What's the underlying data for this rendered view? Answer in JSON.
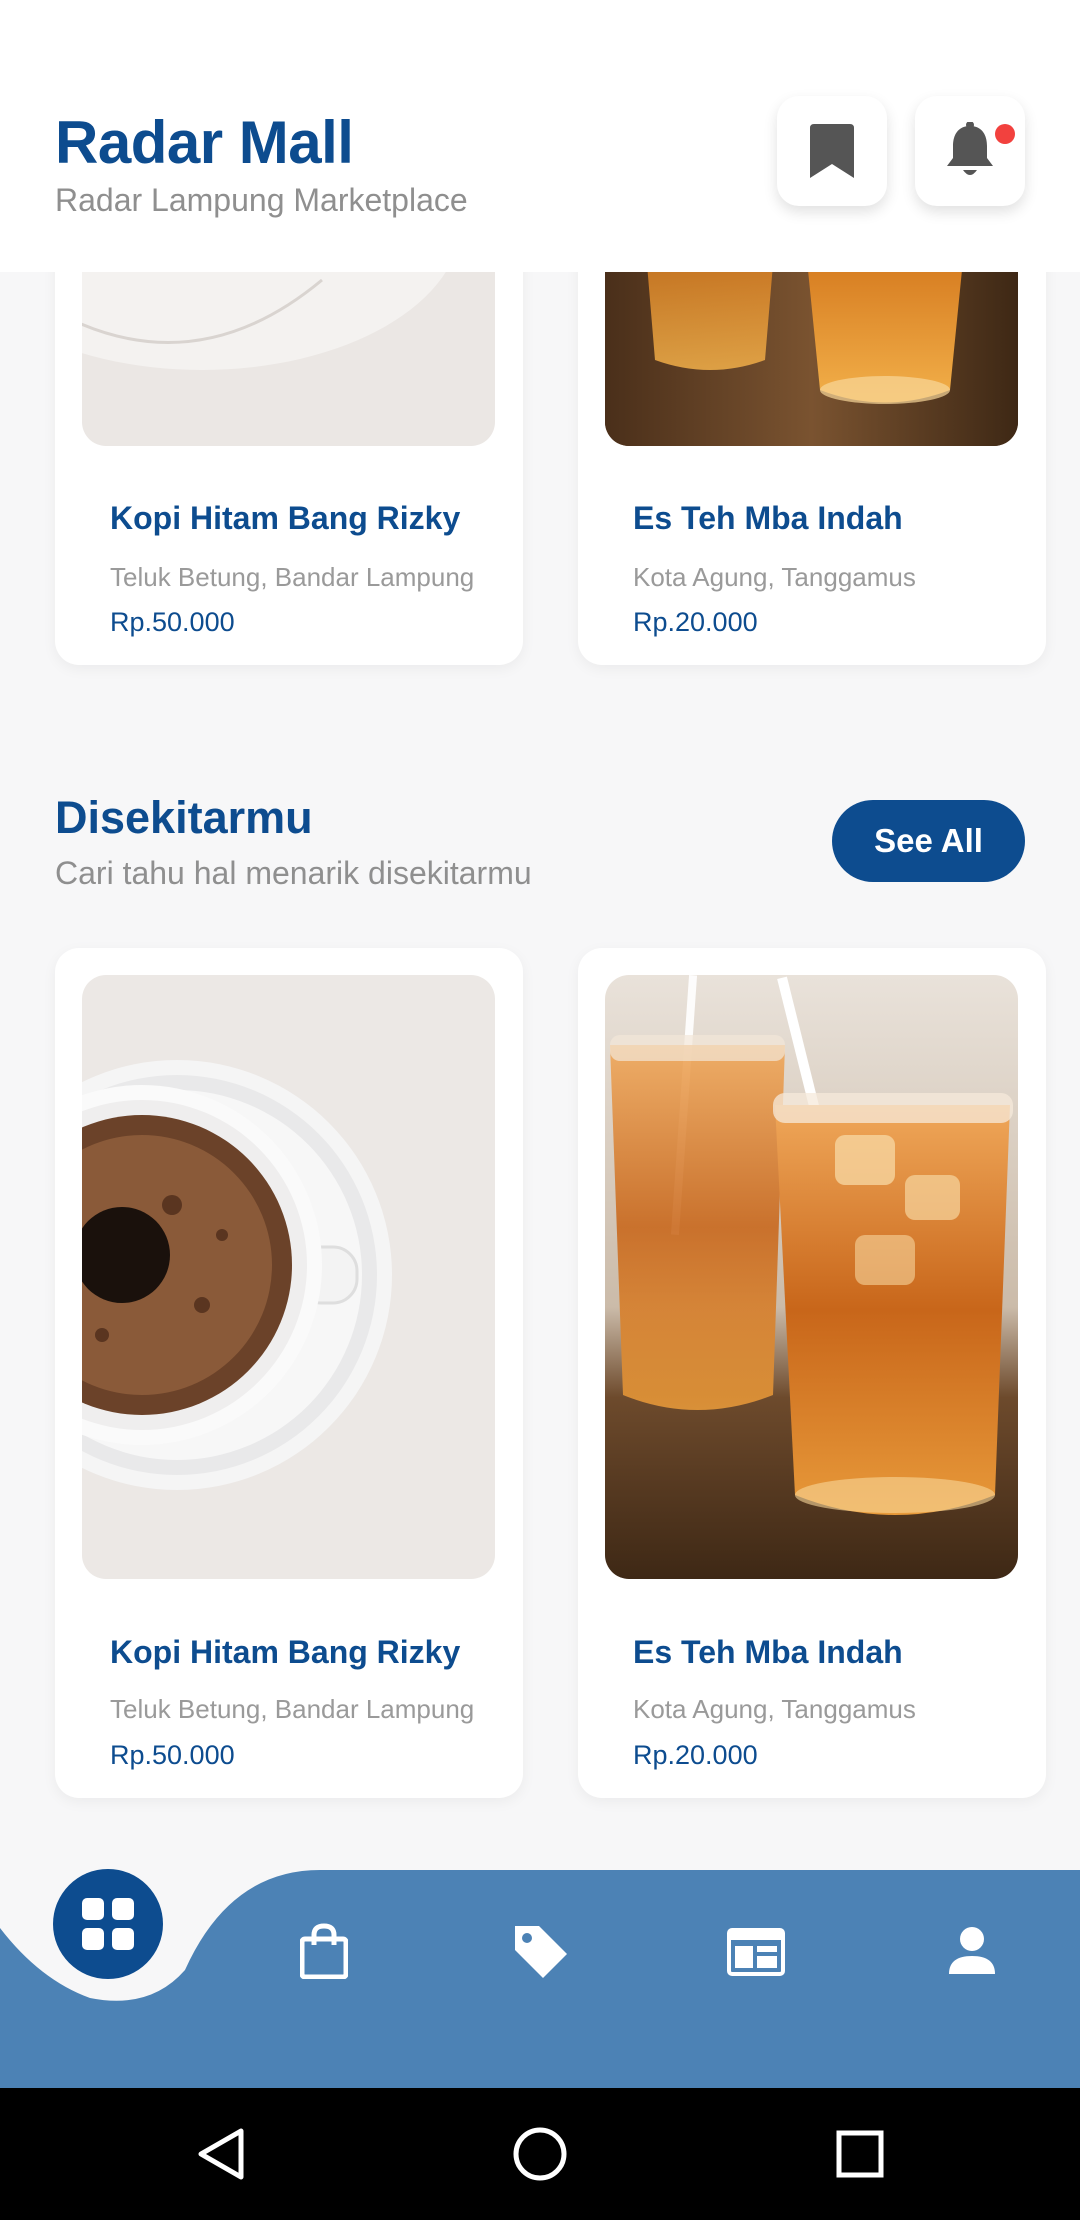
{
  "header": {
    "title": "Radar Mall",
    "subtitle": "Radar Lampung Marketplace",
    "bookmark_icon": "bookmark-icon",
    "bell_icon": "bell-icon",
    "notification_badge_color": "#f2413e"
  },
  "top_cards": [
    {
      "name": "Kopi Hitam Bang Rizky",
      "location": "Teluk Betung, Bandar Lampung",
      "price": "Rp.50.000",
      "image": "coffee"
    },
    {
      "name": "Es Teh Mba Indah",
      "location": "Kota Agung, Tanggamus",
      "price": "Rp.20.000",
      "image": "iced-tea"
    }
  ],
  "nearby": {
    "title": "Disekitarmu",
    "subtitle": "Cari tahu hal menarik disekitarmu",
    "see_all_label": "See All",
    "cards": [
      {
        "name": "Kopi Hitam Bang Rizky",
        "location": "Teluk Betung, Bandar Lampung",
        "price": "Rp.50.000",
        "image": "coffee"
      },
      {
        "name": "Es Teh Mba Indah",
        "location": "Kota Agung, Tanggamus",
        "price": "Rp.20.000",
        "image": "iced-tea"
      }
    ]
  },
  "bottom_nav": {
    "items": [
      "grid-icon",
      "shopping-bag-icon",
      "tag-icon",
      "news-icon",
      "person-icon"
    ],
    "active": "grid-icon"
  },
  "system_nav": [
    "back-icon",
    "home-icon",
    "recents-icon"
  ],
  "colors": {
    "brand": "#0d4c8f",
    "nav_background": "#4c82b5",
    "page_background": "#f7f7f8"
  }
}
